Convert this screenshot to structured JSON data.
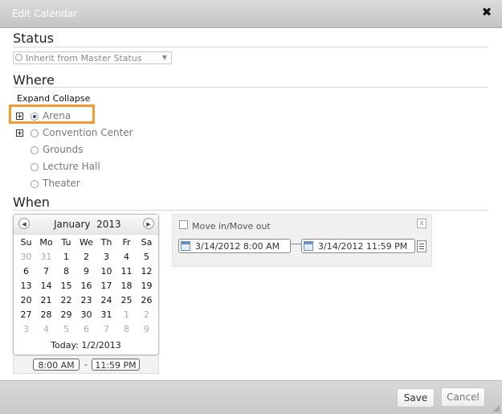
{
  "dialog": {
    "title": "Edit Calendar",
    "close_label": "✖"
  },
  "status": {
    "heading": "Status",
    "select_value": "Inherit from Master Status"
  },
  "where": {
    "heading": "Where",
    "expand_label": "Expand",
    "collapse_label": "Collapse",
    "locations": [
      {
        "label": "Arena",
        "expandable": true,
        "selected": true
      },
      {
        "label": "Convention Center",
        "expandable": true,
        "selected": false
      },
      {
        "label": "Grounds",
        "expandable": false,
        "selected": false
      },
      {
        "label": "Lecture Hall",
        "expandable": false,
        "selected": false
      },
      {
        "label": "Theater",
        "expandable": false,
        "selected": false
      }
    ]
  },
  "when": {
    "heading": "When",
    "calendar": {
      "month": "January",
      "year": "2013",
      "weekdays": [
        "Su",
        "Mo",
        "Tu",
        "We",
        "Th",
        "Fr",
        "Sa"
      ],
      "weeks": [
        [
          "30",
          "31",
          "1",
          "2",
          "3",
          "4",
          "5"
        ],
        [
          "6",
          "7",
          "8",
          "9",
          "10",
          "11",
          "12"
        ],
        [
          "13",
          "14",
          "15",
          "16",
          "17",
          "18",
          "19"
        ],
        [
          "20",
          "21",
          "22",
          "23",
          "24",
          "25",
          "26"
        ],
        [
          "27",
          "28",
          "29",
          "30",
          "31",
          "1",
          "2"
        ],
        [
          "3",
          "4",
          "5",
          "6",
          "7",
          "8",
          "9"
        ]
      ],
      "today_label": "Today: 1/2/2013"
    },
    "start_time": "8:00 AM",
    "end_time": "11:59 PM",
    "time_separator": "-",
    "move": {
      "label": "Move in/Move out",
      "close_label": "x",
      "start": "3/14/2012  8:00 AM",
      "end": "3/14/2012  11:59 PM"
    }
  },
  "footer": {
    "save_label": "Save",
    "cancel_label": "Cancel"
  },
  "colors": {
    "highlight": "#f29a36",
    "radio_dot": "#2a4a86"
  }
}
